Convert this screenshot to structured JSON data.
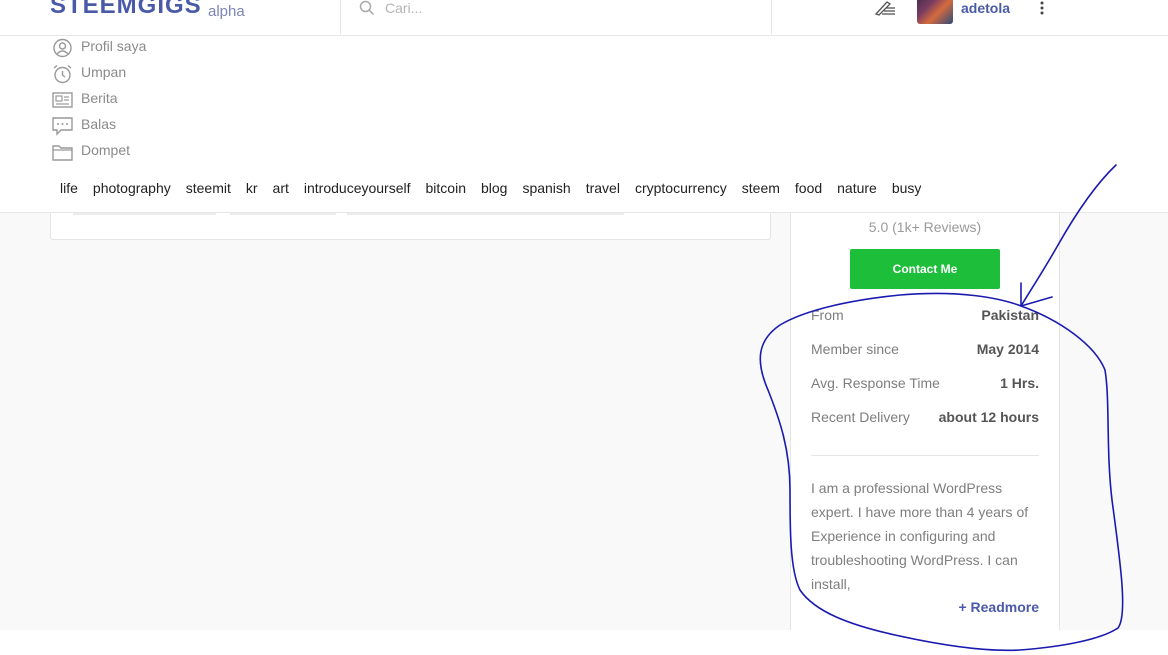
{
  "header": {
    "logo": "STEEMGIGS",
    "logo_suffix": "alpha",
    "search_placeholder": "Cari...",
    "username": "adetola"
  },
  "menu": {
    "items": [
      {
        "label": "Profil saya",
        "icon": "profile-icon"
      },
      {
        "label": "Umpan",
        "icon": "clock-icon"
      },
      {
        "label": "Berita",
        "icon": "news-icon"
      },
      {
        "label": "Balas",
        "icon": "reply-icon"
      },
      {
        "label": "Dompet",
        "icon": "wallet-icon"
      }
    ]
  },
  "tags": [
    "life",
    "photography",
    "steemit",
    "kr",
    "art",
    "introduceyourself",
    "bitcoin",
    "blog",
    "spanish",
    "travel",
    "cryptocurrency",
    "steem",
    "food",
    "nature",
    "busy"
  ],
  "profile": {
    "rating": "5.0 (1k+ Reviews)",
    "contact_label": "Contact Me",
    "from_label": "From",
    "from_value": "Pakistan",
    "member_label": "Member since",
    "member_value": "May 2014",
    "response_label": "Avg. Response Time",
    "response_value": "1 Hrs.",
    "delivery_label": "Recent Delivery",
    "delivery_value": "about 12 hours",
    "about": "I am a professional WordPress expert. I have more than 4 years of Experience in configuring and troubleshooting WordPress. I can install,",
    "readmore": "+ Readmore"
  },
  "colors": {
    "brand": "#4a5aa8",
    "contact_button": "#1dbf3a",
    "annotation_ink": "#1a1ab0"
  }
}
